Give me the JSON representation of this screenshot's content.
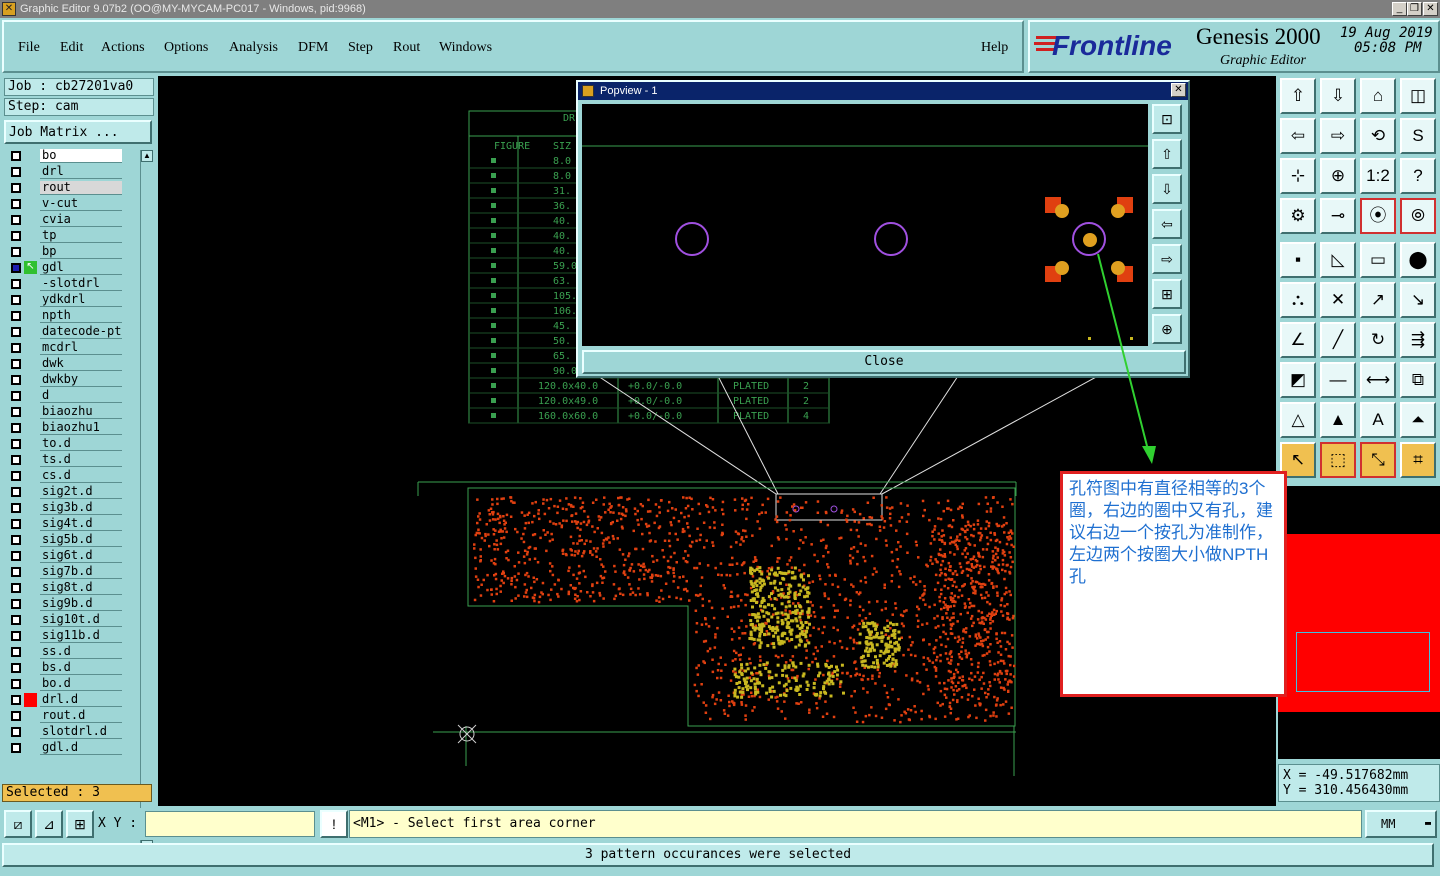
{
  "window": {
    "title": "Graphic Editor 9.07b2 (OO@MY-MYCAM-PC017 - Windows, pid:9968)",
    "controls": [
      "_",
      "❐",
      "✕"
    ]
  },
  "menu": {
    "items": [
      "File",
      "Edit",
      "Actions",
      "Options",
      "Analysis",
      "DFM",
      "Step",
      "Rout",
      "Windows"
    ],
    "help": "Help"
  },
  "brand": {
    "logo": "Frontline",
    "product": "Genesis 2000",
    "subtitle": "Graphic Editor",
    "date": "19 Aug 2019",
    "time": "05:08 PM"
  },
  "job": {
    "job_label": "Job : cb27201va0",
    "step_label": "Step: cam",
    "matrix_button": "Job Matrix ..."
  },
  "layers": [
    {
      "name": "bo",
      "state": "white"
    },
    {
      "name": "drl",
      "state": "plain"
    },
    {
      "name": "rout",
      "state": "light"
    },
    {
      "name": "v-cut",
      "state": "plain"
    },
    {
      "name": "cvia",
      "state": "plain"
    },
    {
      "name": "tp",
      "state": "plain"
    },
    {
      "name": "bp",
      "state": "plain"
    },
    {
      "name": "gdl",
      "state": "work"
    },
    {
      "name": "-slotdrl",
      "state": "plain"
    },
    {
      "name": "ydkdrl",
      "state": "plain"
    },
    {
      "name": "npth",
      "state": "plain"
    },
    {
      "name": "datecode-pte",
      "state": "plain"
    },
    {
      "name": "mcdrl",
      "state": "plain"
    },
    {
      "name": "dwk",
      "state": "plain"
    },
    {
      "name": "dwkby",
      "state": "plain"
    },
    {
      "name": "d",
      "state": "plain"
    },
    {
      "name": "biaozhu",
      "state": "plain"
    },
    {
      "name": "biaozhu1",
      "state": "plain"
    },
    {
      "name": "to.d",
      "state": "plain"
    },
    {
      "name": "ts.d",
      "state": "plain"
    },
    {
      "name": "cs.d",
      "state": "plain"
    },
    {
      "name": "sig2t.d",
      "state": "plain"
    },
    {
      "name": "sig3b.d",
      "state": "plain"
    },
    {
      "name": "sig4t.d",
      "state": "plain"
    },
    {
      "name": "sig5b.d",
      "state": "plain"
    },
    {
      "name": "sig6t.d",
      "state": "plain"
    },
    {
      "name": "sig7b.d",
      "state": "plain"
    },
    {
      "name": "sig8t.d",
      "state": "plain"
    },
    {
      "name": "sig9b.d",
      "state": "plain"
    },
    {
      "name": "sig10t.d",
      "state": "plain"
    },
    {
      "name": "sig11b.d",
      "state": "plain"
    },
    {
      "name": "ss.d",
      "state": "plain"
    },
    {
      "name": "bs.d",
      "state": "plain"
    },
    {
      "name": "bo.d",
      "state": "plain"
    },
    {
      "name": "drl.d",
      "state": "red"
    },
    {
      "name": "rout.d",
      "state": "plain"
    },
    {
      "name": "slotdrl.d",
      "state": "plain"
    },
    {
      "name": "gdl.d",
      "state": "plain"
    }
  ],
  "selected_label": "Selected : 3",
  "drill_table": {
    "header_title": "DR",
    "col_figure": "FIGURE",
    "col_size": "SIZ",
    "sizes": [
      "8.0",
      "8.0",
      "31.",
      "36.",
      "40.",
      "40.",
      "40.",
      "59.0",
      "63.",
      "105.",
      "106.",
      "45.",
      "50.",
      "65.",
      "90.0x4",
      "120.0x40.0",
      "120.0x49.0",
      "160.0x60.0"
    ],
    "tolerance": [
      "+0.0/-0.0",
      "+0.0/-0.0",
      "+0.0/-0.0"
    ],
    "plated": [
      "PLATED",
      "PLATED",
      "PLATED"
    ],
    "qty": [
      "2",
      "2",
      "4"
    ]
  },
  "popview": {
    "title": "Popview - 1",
    "close": "Close",
    "tools": [
      "zoom-fit-icon",
      "page-up-icon",
      "page-down-icon",
      "page-left-icon",
      "page-right-icon",
      "zoom-in-icon",
      "zoom-out-icon"
    ]
  },
  "annotation": {
    "text": "孔符图中有直径相等的3个圈，右边的圈中又有孔，建议右边一个按孔为准制作，左边两个按圈大小做NPTH孔"
  },
  "coords": {
    "x": "X = -49.517682mm",
    "y": "Y = 310.456430mm"
  },
  "command": {
    "xy_label": "X Y :",
    "xy_value": "",
    "prompt": "<M1> - Select first area corner",
    "units": "MM"
  },
  "status": "3 pattern occurances were selected",
  "colors": {
    "panel": "#9ed6d6",
    "canvas": "#000000",
    "layer_work": "#1e1eb0",
    "layer_red": "#ff0000",
    "feature_red": "#e04010",
    "feature_yellow": "#c8b820",
    "outline": "#3aa050",
    "annotation": "#1e6fd0"
  }
}
